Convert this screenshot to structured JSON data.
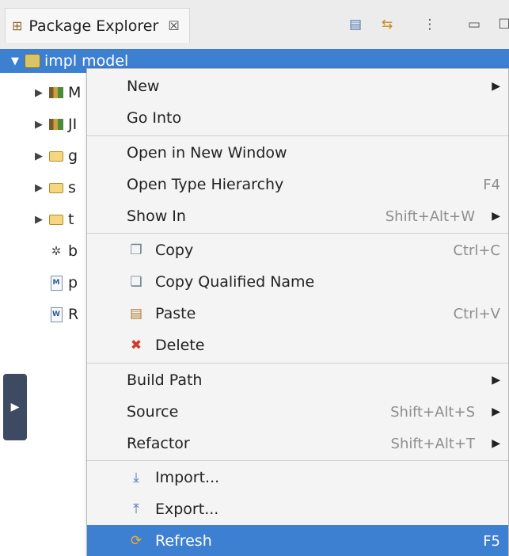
{
  "view": {
    "title": "Package Explorer",
    "close_glyph": "☒",
    "toolbar_icons": [
      "collapse-all-icon",
      "link-with-editor-icon",
      "view-menu-icon",
      "minimize-icon",
      "maximize-icon"
    ]
  },
  "tree": {
    "selected_label": "impl model",
    "children": [
      {
        "label": "M",
        "icon": "library-icon",
        "twisty": "▶"
      },
      {
        "label": "JI",
        "icon": "library-icon",
        "twisty": "▶"
      },
      {
        "label": "g",
        "icon": "folder-icon",
        "twisty": "▶"
      },
      {
        "label": "s",
        "icon": "folder-icon",
        "twisty": "▶"
      },
      {
        "label": "t",
        "icon": "folder-icon",
        "twisty": "▶"
      },
      {
        "label": "b",
        "icon": "bin-icon",
        "twisty": ""
      },
      {
        "label": "p",
        "icon": "maven-pom-icon",
        "twisty": ""
      },
      {
        "label": "R",
        "icon": "readme-icon",
        "twisty": ""
      }
    ]
  },
  "menu": {
    "items": [
      {
        "label": "New",
        "accelerator": "",
        "submenu": true
      },
      {
        "label": "Go Into",
        "accelerator": "",
        "submenu": false
      },
      {
        "label": "Open in New Window",
        "accelerator": "",
        "submenu": false
      },
      {
        "label": "Open Type Hierarchy",
        "accelerator": "F4",
        "submenu": false
      },
      {
        "label": "Show In",
        "accelerator": "Shift+Alt+W",
        "submenu": true
      },
      {
        "label": "Copy",
        "accelerator": "Ctrl+C",
        "icon": "copy-icon"
      },
      {
        "label": "Copy Qualified Name",
        "accelerator": "",
        "icon": "copy-qualified-name-icon"
      },
      {
        "label": "Paste",
        "accelerator": "Ctrl+V",
        "icon": "paste-icon"
      },
      {
        "label": "Delete",
        "accelerator": "",
        "icon": "delete-icon"
      },
      {
        "label": "Build Path",
        "accelerator": "",
        "submenu": true
      },
      {
        "label": "Source",
        "accelerator": "Shift+Alt+S",
        "submenu": true
      },
      {
        "label": "Refactor",
        "accelerator": "Shift+Alt+T",
        "submenu": true
      },
      {
        "label": "Import...",
        "accelerator": "",
        "icon": "import-icon"
      },
      {
        "label": "Export...",
        "accelerator": "",
        "icon": "export-icon"
      },
      {
        "label": "Refresh",
        "accelerator": "F5",
        "icon": "refresh-icon",
        "active": true
      }
    ]
  },
  "colors": {
    "selection": "#3d7fd0",
    "menu_bg": "#f4f4f4",
    "accelerator_text": "#8e8e8e"
  }
}
